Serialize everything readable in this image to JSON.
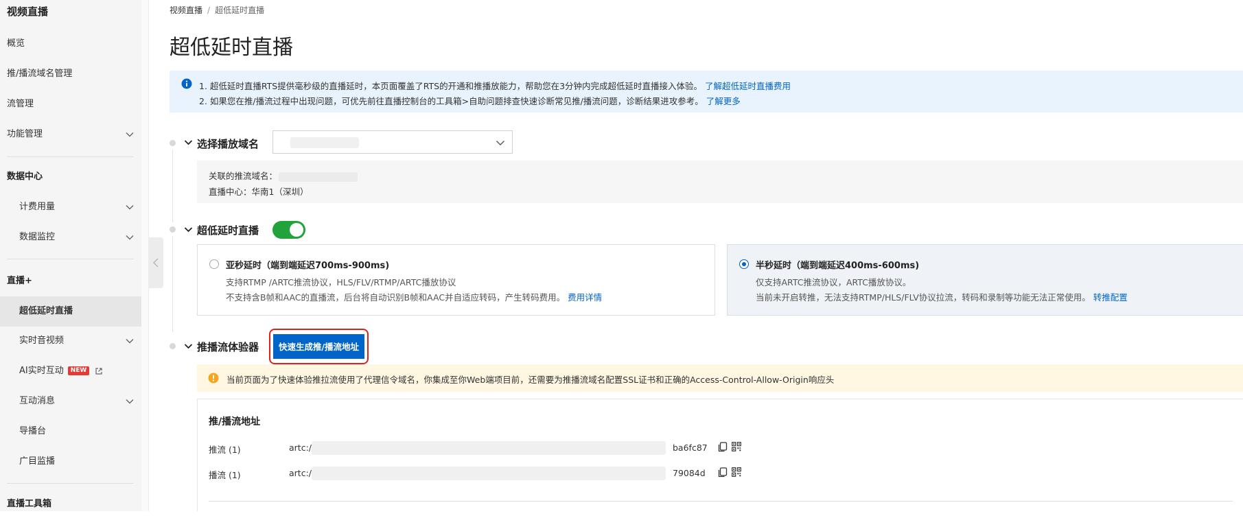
{
  "sidebar": {
    "title": "视频直播",
    "items": [
      {
        "label": "概览"
      },
      {
        "label": "推/播流域名管理"
      },
      {
        "label": "流管理"
      },
      {
        "label": "功能管理"
      },
      {
        "label": "数据中心"
      },
      {
        "label": "计费用量"
      },
      {
        "label": "数据监控"
      },
      {
        "label": "直播+"
      },
      {
        "label": "超低延时直播"
      },
      {
        "label": "实时音视频"
      },
      {
        "label": "AI实时互动",
        "badge": "NEW"
      },
      {
        "label": "互动消息"
      },
      {
        "label": "导播台"
      },
      {
        "label": "广目监播"
      },
      {
        "label": "直播工具箱"
      }
    ]
  },
  "breadcrumb": {
    "root": "视频直播",
    "separator": "/",
    "current": "超低延时直播"
  },
  "page_title": "超低延时直播",
  "info": {
    "line1": "1. 超低延时直播RTS提供毫秒级的直播延时，本页面覆盖了RTS的开通和推播放能力，帮助您在3分钟内完成超低延时直播接入体验。",
    "line1_link": "了解超低延时直播费用",
    "line2": "2. 如果您在推/播流过程中出现问题，可优先前往直播控制台的工具箱>自助问题排查快速诊断常见推/播流问题，诊断结果进攻参考。",
    "line2_link": "了解更多"
  },
  "step1": {
    "title": "选择播放域名",
    "push_domain_label": "关联的推流域名：",
    "center_label": "直播中心：华南1（深圳）"
  },
  "step2": {
    "title": "超低延时直播",
    "toggle_on": true,
    "option_a": {
      "title": "亚秒延时（端到端延迟700ms-900ms)",
      "line1": "支持RTMP /ARTC推流协议，HLS/FLV/RTMP/ARTC播放协议",
      "line2": "不支持含B帧和AAC的直播流，后台将自动识别B帧和AAC并自适应转码，产生转码费用。",
      "link": "费用详情",
      "selected": false
    },
    "option_b": {
      "title": "半秒延时（端到端延迟400ms-600ms)",
      "line1": "仅支持ARTC推流协议，ARTC播放协议。",
      "line2": "当前未开启转推，无法支持RTMP/HLS/FLV协议拉流，转码和录制等功能无法正常使用。",
      "link": "转推配置",
      "selected": true
    }
  },
  "step3": {
    "title": "推播流体验器",
    "button": "快速生成推/播流地址",
    "warning": "当前页面为了快速体验推拉流使用了代理信令域名，你集成至你Web端项目前，还需要为推播流域名配置SSL证书和正确的Access-Control-Allow-Origin响应头",
    "url_title": "推/播流地址",
    "push": {
      "label": "推流 (1)",
      "prefix": "artc://",
      "suffix": "ba6fc87"
    },
    "play": {
      "label": "播流 (1)",
      "prefix": "artc://",
      "suffix": "79084d"
    }
  },
  "colors": {
    "accent": "#0064c8",
    "toggle": "#20a33a",
    "highlight": "#e0201b"
  }
}
